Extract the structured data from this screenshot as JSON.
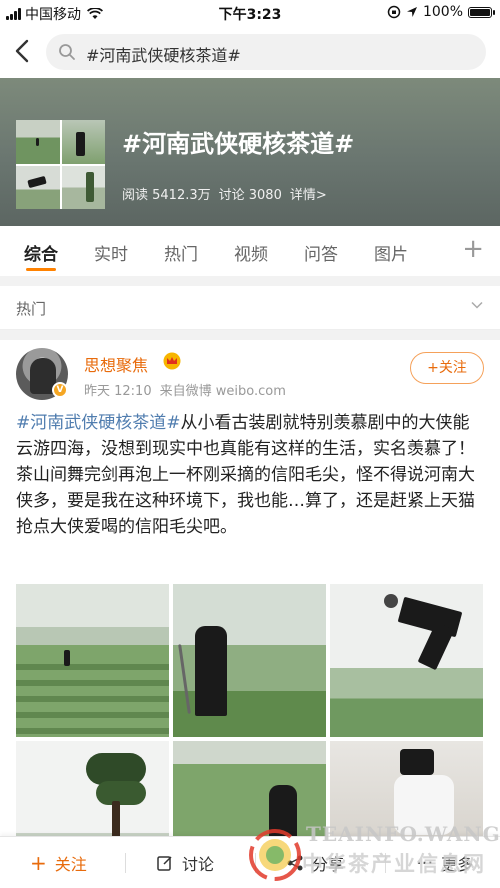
{
  "status_bar": {
    "carrier": "中国移动",
    "time": "下午3:23",
    "battery": "100%",
    "battery_level": 1.0
  },
  "search": {
    "query": "#河南武侠硬核茶道#"
  },
  "topic": {
    "title": "#河南武侠硬核茶道#",
    "reads": "阅读 5412.3万",
    "discussions": "讨论 3080",
    "detail_link": "详情>"
  },
  "tabs": [
    "综合",
    "实时",
    "热门",
    "视频",
    "问答",
    "图片"
  ],
  "active_tab": "综合",
  "section": {
    "title": "热门"
  },
  "post": {
    "author": "思想聚焦",
    "time": "昨天 12:10",
    "source": "来自微博 weibo.com",
    "follow_label": "+关注",
    "hashtag": "#河南武侠硬核茶道#",
    "body": "从小看古装剧就特别羡慕剧中的大侠能云游四海，没想到现实中也真能有这样的生活，实名羡慕了！茶山间舞完剑再泡上一杯刚采摘的信阳毛尖，怪不得说河南大侠多，要是我在这种环境下，我也能…算了，还是赶紧上天猫抢点大侠爱喝的信阳毛尖吧。",
    "image_count": 6
  },
  "bottom_bar": {
    "follow": "关注",
    "comment": "讨论",
    "share": "分享",
    "more": "更多"
  },
  "watermark": {
    "line1": "TEAINFO.WANG",
    "line2": "中华茶产业信息网"
  },
  "colors": {
    "accent": "#ff8200",
    "link": "#507daf",
    "author": "#e86b0c"
  }
}
